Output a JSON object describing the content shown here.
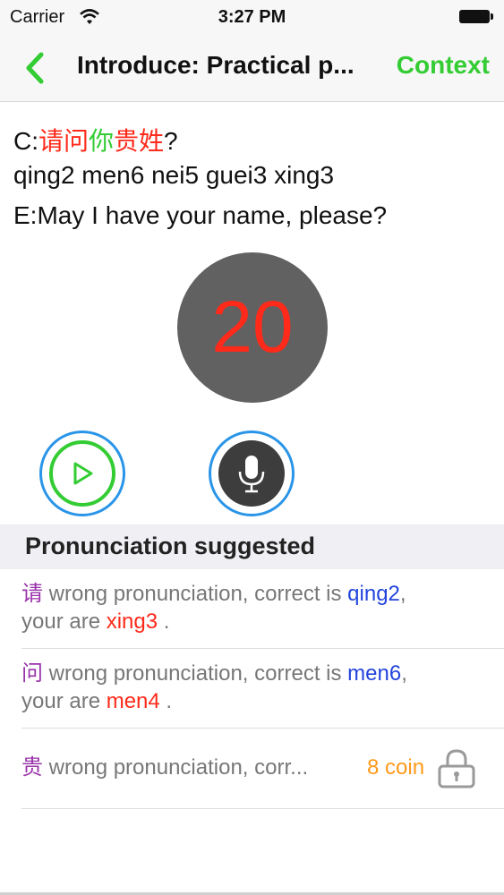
{
  "status_bar": {
    "carrier": "Carrier",
    "time": "3:27 PM"
  },
  "nav": {
    "title": "Introduce: Practical p...",
    "right_button": "Context"
  },
  "sentence": {
    "chinese_prefix": "C:",
    "chars": [
      {
        "text": "请问",
        "color": "#ff2a1a"
      },
      {
        "text": "你",
        "color": "#33cc33"
      },
      {
        "text": "贵姓",
        "color": "#ff2a1a"
      }
    ],
    "chinese_suffix": "?",
    "pinyin": "qing2 men6 nei5 guei3 xing3",
    "english": "E:May I have your name, please?"
  },
  "score": {
    "value": "20"
  },
  "section": {
    "title": "Pronunciation suggested"
  },
  "suggestions": [
    {
      "char": "请",
      "text1": " wrong pronunciation, correct is ",
      "correct": "qing2",
      "text2": ",",
      "text3": "your are ",
      "yours": "xing3",
      "text4": " ."
    },
    {
      "char": "问",
      "text1": " wrong pronunciation, correct is ",
      "correct": "men6",
      "text2": ",",
      "text3": "your are ",
      "yours": "men4",
      "text4": " ."
    },
    {
      "char": "贵",
      "text1": " wrong pronunciation, corr...",
      "coin": "8 coin"
    }
  ],
  "colors": {
    "accent_green": "#33cc33",
    "accent_blue": "#2a95e8",
    "error_red": "#ff2a1a",
    "coin_orange": "#ff9a1a"
  },
  "icons": [
    "back-chevron-icon",
    "wifi-icon",
    "battery-icon",
    "play-icon",
    "microphone-icon",
    "lock-icon"
  ]
}
